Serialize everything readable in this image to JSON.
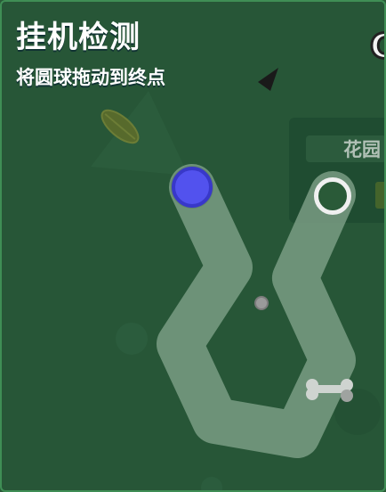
{
  "captcha": {
    "title": "挂机检测",
    "instruction": "将圆球拖动到终点"
  },
  "background": {
    "panel_label": "花园",
    "corner_glyph": "C"
  },
  "icons": {
    "start": "blue-ball-icon",
    "goal": "goal-ring-icon",
    "decor": [
      "leaf-icon",
      "bone-icon",
      "small-stone-icon",
      "dark-shard-icon"
    ]
  },
  "colors": {
    "field": "#275637",
    "border": "#3f8e55",
    "path": "#7a9c84",
    "ball_fill": "#5252ee",
    "ball_stroke": "#3838c9",
    "goal_ring": "#f0f0f0"
  }
}
